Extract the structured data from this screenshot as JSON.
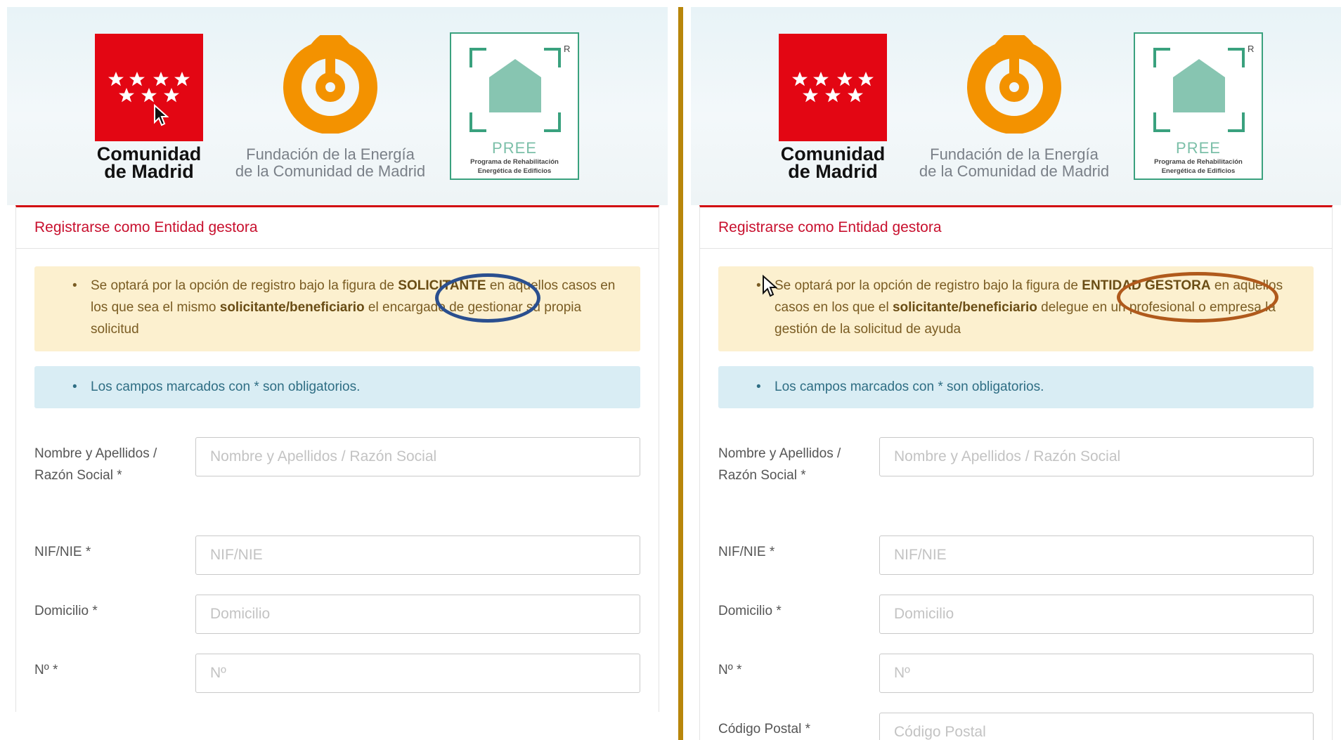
{
  "left_panel": {
    "logos": {
      "comunidad_line1": "Comunidad",
      "comunidad_line2": "de Madrid",
      "fundacion_line1": "Fundación de la Energía",
      "fundacion_line2": "de la Comunidad de Madrid",
      "pree_word": "PREE",
      "pree_sub1": "Programa de Rehabilitación",
      "pree_sub2": "Energética de Edificios",
      "pree_mark": "R"
    },
    "title": "Registrarse como Entidad gestora",
    "warning": {
      "part1": "Se optará por la opción de registro bajo la figura de ",
      "highlight": "SOLICITANTE",
      "part2": " en aquellos casos en los que sea el mismo ",
      "bold": "solicitante/beneficiario",
      "part3": " el encargado de gestionar su propia solicitud"
    },
    "info": "Los campos marcados con * son obligatorios.",
    "fields": [
      {
        "label": "Nombre y Apellidos / Razón Social *",
        "placeholder": "Nombre y Apellidos / Razón Social",
        "value": ""
      },
      {
        "label": "NIF/NIE *",
        "placeholder": "NIF/NIE",
        "value": ""
      },
      {
        "label": "Domicilio *",
        "placeholder": "Domicilio",
        "value": ""
      },
      {
        "label": "Nº *",
        "placeholder": "Nº",
        "value": ""
      }
    ]
  },
  "right_panel": {
    "logos": {
      "comunidad_line1": "Comunidad",
      "comunidad_line2": "de Madrid",
      "fundacion_line1": "Fundación de la Energía",
      "fundacion_line2": "de la Comunidad de Madrid",
      "pree_word": "PREE",
      "pree_sub1": "Programa de Rehabilitación",
      "pree_sub2": "Energética de Edificios",
      "pree_mark": "R"
    },
    "title": "Registrarse como Entidad gestora",
    "warning": {
      "part1": "Se optará por la opción de registro bajo la figura de ",
      "highlight": "ENTIDAD GESTORA",
      "part2": " en aquellos casos en los que el ",
      "bold": "solicitante/beneficiario",
      "part3": " delegue en un profesional o empresa la gestión de la solicitud de ayuda"
    },
    "info": "Los campos marcados con * son obligatorios.",
    "fields": [
      {
        "label": "Nombre y Apellidos / Razón Social *",
        "placeholder": "Nombre y Apellidos / Razón Social",
        "value": ""
      },
      {
        "label": "NIF/NIE *",
        "placeholder": "NIF/NIE",
        "value": ""
      },
      {
        "label": "Domicilio *",
        "placeholder": "Domicilio",
        "value": ""
      },
      {
        "label": "Nº *",
        "placeholder": "Nº",
        "value": ""
      },
      {
        "label": "Código Postal *",
        "placeholder": "Código Postal",
        "value": ""
      }
    ]
  },
  "colors": {
    "madrid_red": "#e30613",
    "fundacion_orange": "#f39200",
    "pree_green": "#3aa17e",
    "title_red": "#c8102e",
    "divider_gold": "#b8860b",
    "annotation_blue": "#2a4f8f",
    "annotation_brown": "#b05a1c"
  }
}
